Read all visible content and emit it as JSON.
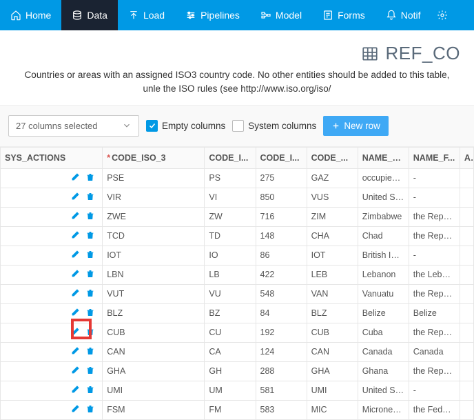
{
  "nav": [
    {
      "label": "Home",
      "icon": "home",
      "active": false
    },
    {
      "label": "Data",
      "icon": "data",
      "active": true
    },
    {
      "label": "Load",
      "icon": "load",
      "active": false
    },
    {
      "label": "Pipelines",
      "icon": "pipelines",
      "active": false
    },
    {
      "label": "Model",
      "icon": "model",
      "active": false
    },
    {
      "label": "Forms",
      "icon": "forms",
      "active": false
    },
    {
      "label": "Notif",
      "icon": "notif",
      "active": false
    }
  ],
  "page": {
    "title": "REF_CO",
    "description": "Countries or areas with an assigned ISO3 country code. No other entities should be added to this table, unle the ISO rules (see http://www.iso.org/iso/"
  },
  "controls": {
    "columns_selected": "27 columns selected",
    "empty_cols_label": "Empty columns",
    "empty_cols_checked": true,
    "system_cols_label": "System columns",
    "system_cols_checked": false,
    "new_row_label": "New row"
  },
  "table": {
    "headers": [
      "SYS_ACTIONS",
      "CODE_ISO_3",
      "CODE_I...",
      "CODE_I...",
      "CODE_...",
      "NAME_S...",
      "NAME_F...",
      "A"
    ],
    "code_iso3_required": true,
    "rows": [
      {
        "iso3": "PSE",
        "c2": "PS",
        "c3": "275",
        "c4": "GAZ",
        "short": "occupied Pal",
        "full": "-"
      },
      {
        "iso3": "VIR",
        "c2": "VI",
        "c3": "850",
        "c4": "VUS",
        "short": "United States",
        "full": "-"
      },
      {
        "iso3": "ZWE",
        "c2": "ZW",
        "c3": "716",
        "c4": "ZIM",
        "short": "Zimbabwe",
        "full": "the Republic"
      },
      {
        "iso3": "TCD",
        "c2": "TD",
        "c3": "148",
        "c4": "CHA",
        "short": "Chad",
        "full": "the Republic"
      },
      {
        "iso3": "IOT",
        "c2": "IO",
        "c3": "86",
        "c4": "IOT",
        "short": "British Indian",
        "full": "-"
      },
      {
        "iso3": "LBN",
        "c2": "LB",
        "c3": "422",
        "c4": "LEB",
        "short": "Lebanon",
        "full": "the Lebanese"
      },
      {
        "iso3": "VUT",
        "c2": "VU",
        "c3": "548",
        "c4": "VAN",
        "short": "Vanuatu",
        "full": "the Republic"
      },
      {
        "iso3": "BLZ",
        "c2": "BZ",
        "c3": "84",
        "c4": "BLZ",
        "short": "Belize",
        "full": "Belize"
      },
      {
        "iso3": "CUB",
        "c2": "CU",
        "c3": "192",
        "c4": "CUB",
        "short": "Cuba",
        "full": "the Republic"
      },
      {
        "iso3": "CAN",
        "c2": "CA",
        "c3": "124",
        "c4": "CAN",
        "short": "Canada",
        "full": "Canada"
      },
      {
        "iso3": "GHA",
        "c2": "GH",
        "c3": "288",
        "c4": "GHA",
        "short": "Ghana",
        "full": "the Republic"
      },
      {
        "iso3": "UMI",
        "c2": "UM",
        "c3": "581",
        "c4": "UMI",
        "short": "United States",
        "full": "-"
      },
      {
        "iso3": "FSM",
        "c2": "FM",
        "c3": "583",
        "c4": "MIC",
        "short": "Micronesia (F",
        "full": "the Federate"
      }
    ],
    "highlight_row_index": 8
  }
}
